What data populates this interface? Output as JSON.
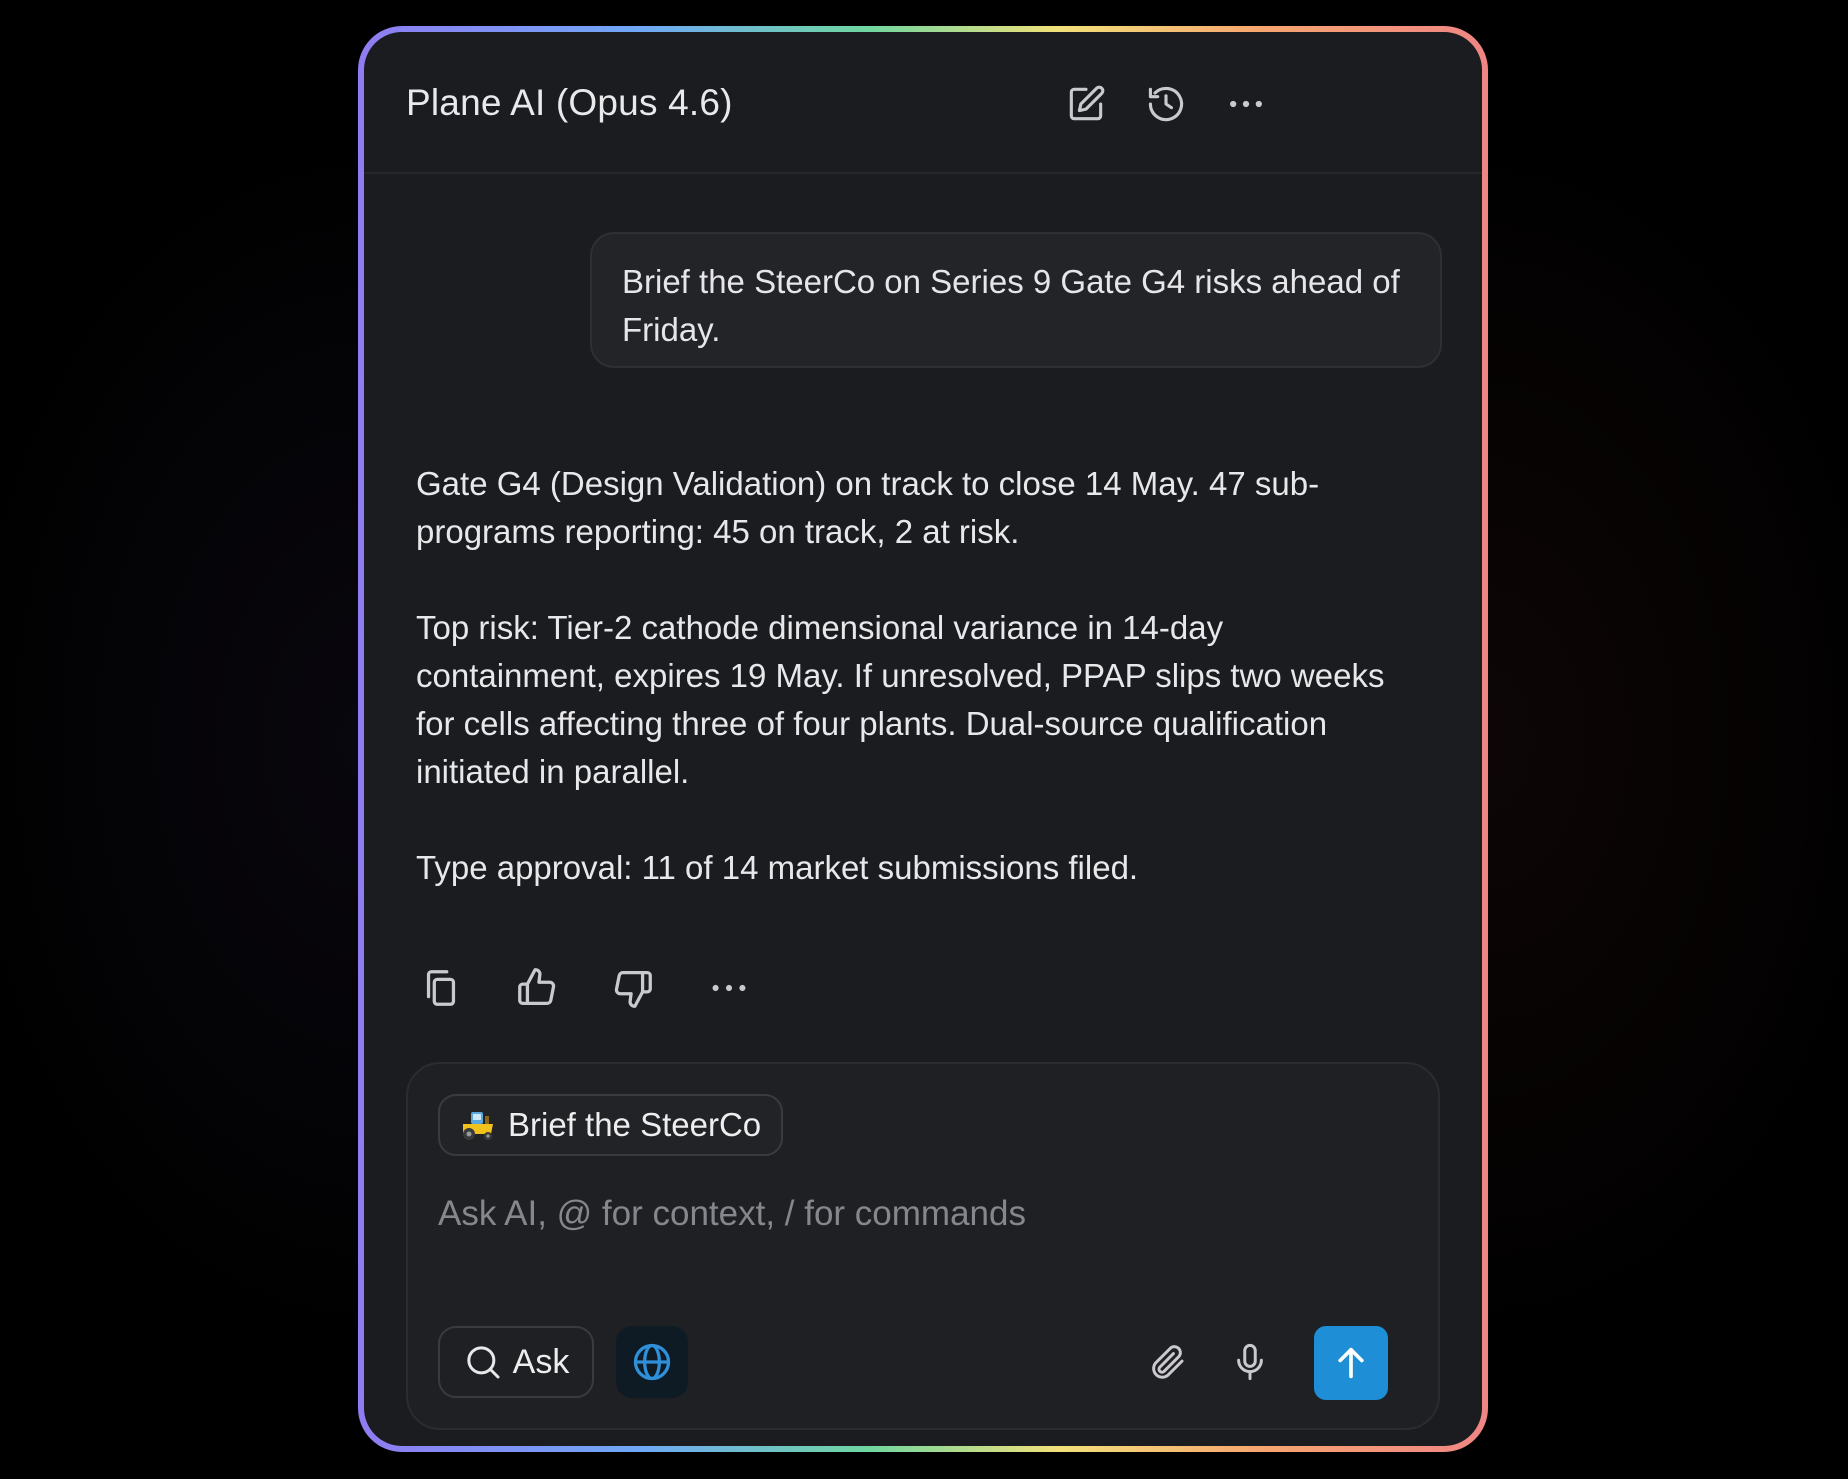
{
  "header": {
    "title": "Plane AI (Opus 4.6)",
    "icons": [
      "new-chat-icon",
      "history-icon",
      "more-icon"
    ]
  },
  "conversation": {
    "user_message": "Brief the SteerCo on Series 9 Gate G4 risks ahead of Friday.",
    "response": [
      "Gate G4 (Design Validation) on track to close 14 May. 47 sub-programs reporting: 45 on track, 2 at risk.",
      "Top risk: Tier-2 cathode dimensional variance in 14-day containment, expires 19 May. If unresolved, PPAP slips two weeks for cells affecting three of four plants. Dual-source qualification initiated in parallel.",
      "Type approval: 11 of 14 market submissions filed."
    ],
    "actions": [
      "copy-icon",
      "thumbs-up-icon",
      "thumbs-down-icon",
      "more-icon"
    ]
  },
  "composer": {
    "chip_label": "Brief the SteerCo",
    "chip_icon": "tractor-icon",
    "placeholder": "Ask AI, @ for context, / for commands",
    "value": "",
    "mode_label": "Ask",
    "web_search_active": true
  },
  "colors": {
    "background": "#000000",
    "panel": "#1b1c1f",
    "send_button": "#1e8fd6",
    "web_icon": "#2f8fd8"
  }
}
